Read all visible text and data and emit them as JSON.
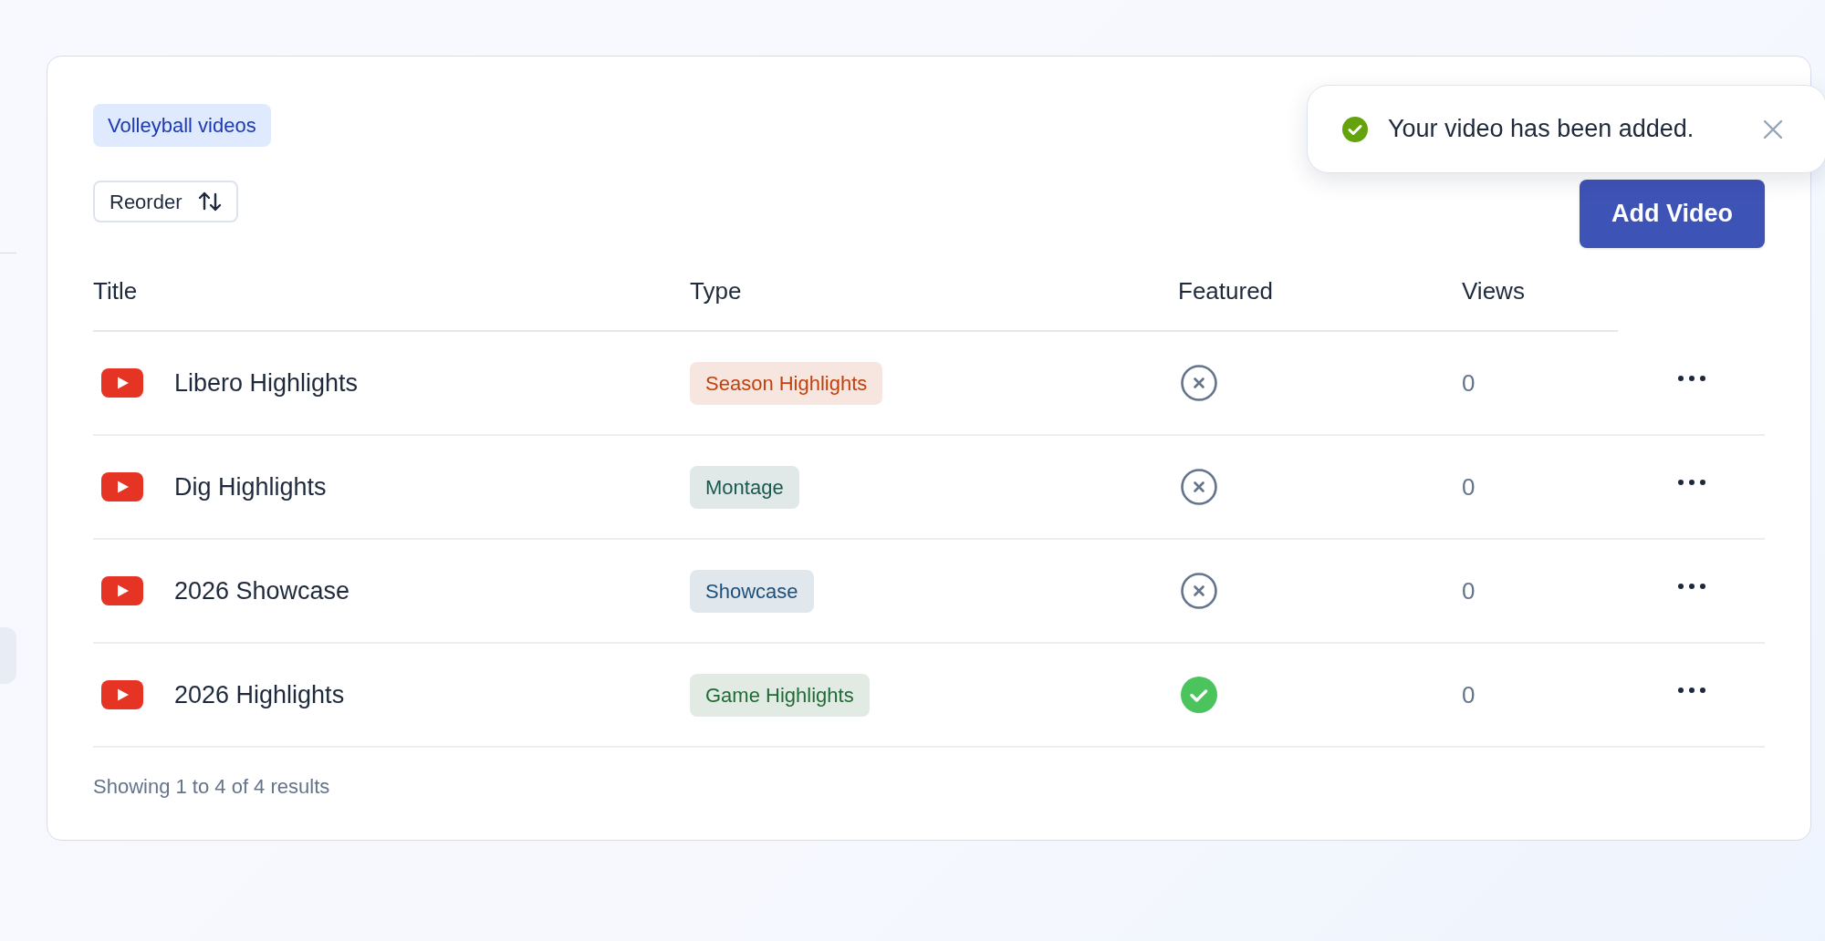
{
  "collection_tag": "Volleyball videos",
  "reorder_button": "Reorder",
  "add_button": "Add Video",
  "toast": {
    "message": "Your video has been added."
  },
  "table": {
    "columns": [
      "Title",
      "Type",
      "Featured",
      "Views"
    ],
    "rows": [
      {
        "title": "Libero Highlights",
        "type": {
          "label": "Season Highlights",
          "color": "#c2410c"
        },
        "featured": false,
        "views": "0"
      },
      {
        "title": "Dig Highlights",
        "type": {
          "label": "Montage",
          "color": "#17594f"
        },
        "featured": false,
        "views": "0"
      },
      {
        "title": "2026 Showcase",
        "type": {
          "label": "Showcase",
          "color": "#1e4f7a"
        },
        "featured": false,
        "views": "0"
      },
      {
        "title": "2026 Highlights",
        "type": {
          "label": "Game Highlights",
          "color": "#1f6b35"
        },
        "featured": true,
        "views": "0"
      }
    ]
  },
  "footer": "Showing 1 to 4 of 4 results"
}
